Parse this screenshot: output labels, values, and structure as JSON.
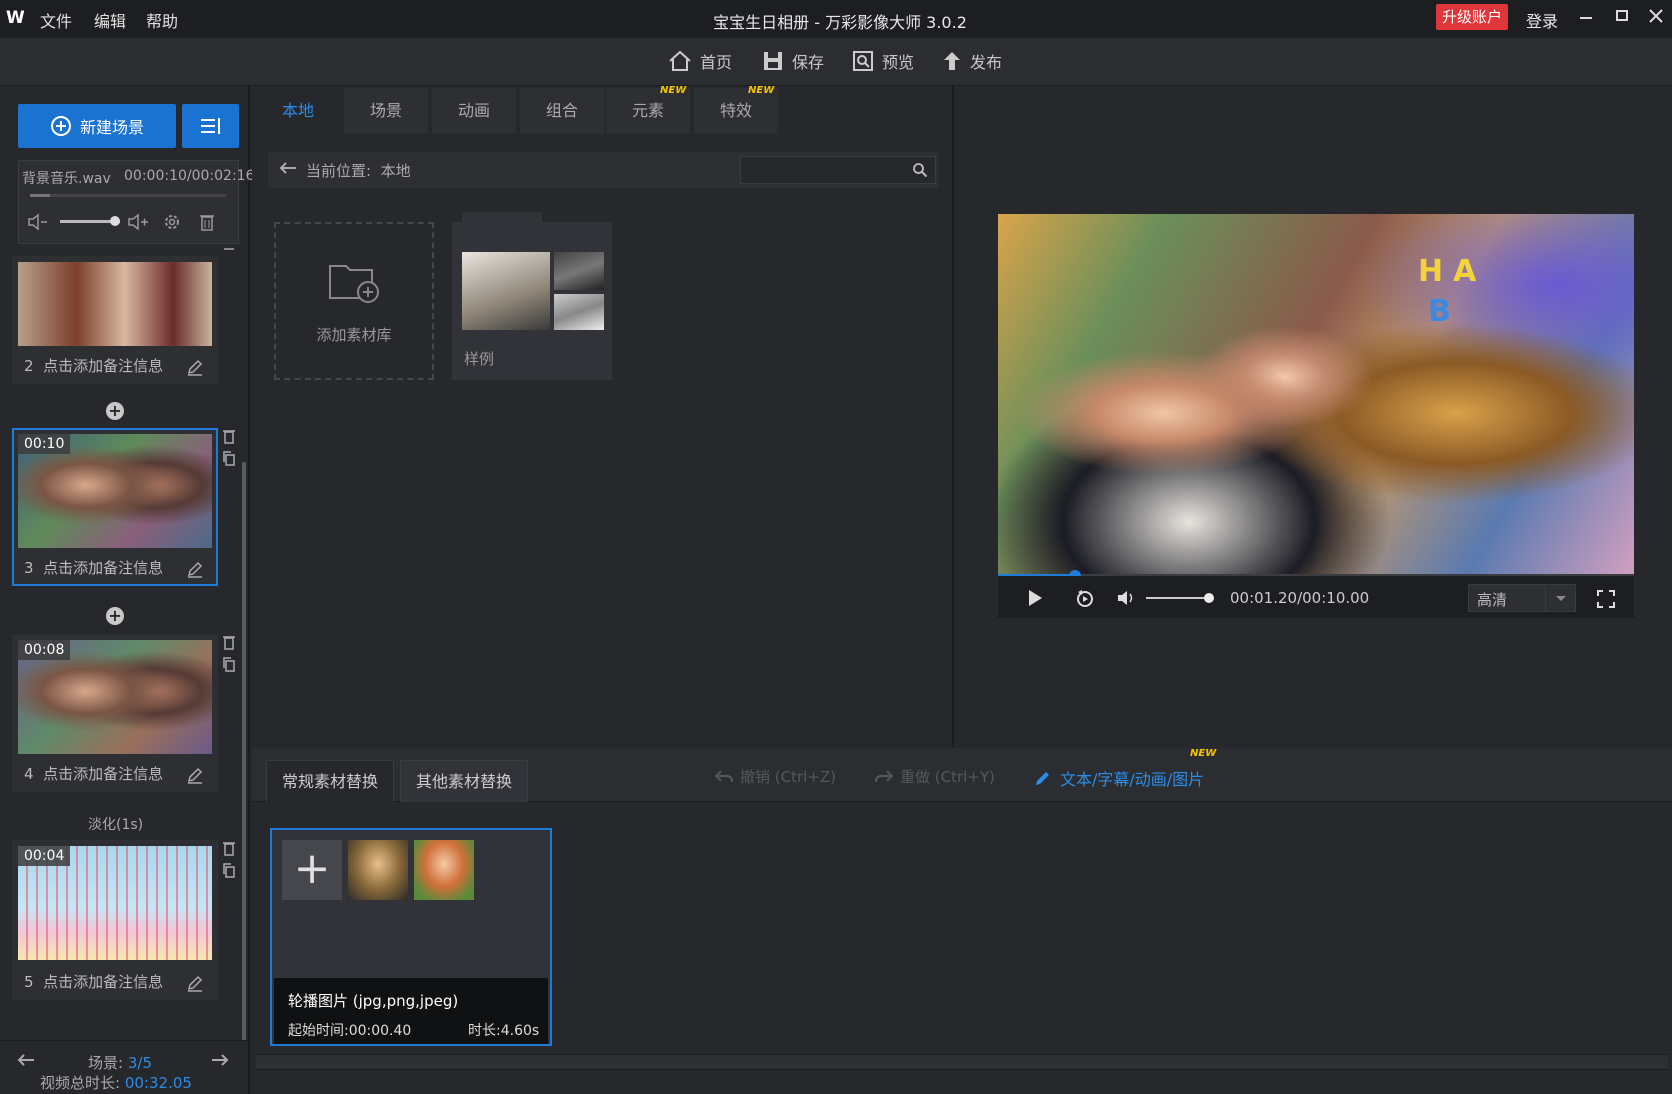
{
  "app": {
    "logo": "W",
    "title": "宝宝生日相册 - 万彩影像大师 3.0.2"
  },
  "menu": {
    "file": "文件",
    "edit": "编辑",
    "help": "帮助"
  },
  "account": {
    "upgrade": "升级账户",
    "login": "登录"
  },
  "toolbar": {
    "home": "首页",
    "save": "保存",
    "preview": "预览",
    "publish": "发布"
  },
  "left": {
    "new_scene": "新建场景",
    "music": {
      "name": "背景音乐.wav",
      "time": "00:00:10/00:02:16"
    },
    "scenes": [
      {
        "number": "2",
        "note": "点击添加备注信息",
        "duration": ""
      },
      {
        "number": "3",
        "note": "点击添加备注信息",
        "duration": "00:10"
      },
      {
        "number": "4",
        "note": "点击添加备注信息",
        "duration": "00:08"
      },
      {
        "number": "5",
        "note": "点击添加备注信息",
        "duration": "00:04"
      }
    ],
    "transition": "淡化(1s)",
    "footer": {
      "scene_label": "场景:",
      "scene_value": "3/5",
      "duration_label": "视频总时长:",
      "duration_value": "00:32.05"
    }
  },
  "library": {
    "tabs": [
      "本地",
      "场景",
      "动画",
      "组合",
      "元素",
      "特效"
    ],
    "new_badge": "NEW",
    "path_label": "当前位置:",
    "path_value": "本地",
    "search": {
      "placeholder": ""
    },
    "add_library": "添加素材库",
    "sample_folder": "样例"
  },
  "player": {
    "time": "00:01.20/00:10.00",
    "quality": "高清",
    "progress": 0.12
  },
  "bottom": {
    "tabs": [
      "常规素材替换",
      "其他素材替换"
    ],
    "undo": "撤销 (Ctrl+Z)",
    "redo": "重做 (Ctrl+Y)",
    "text_edit": "文本/字幕/动画/图片",
    "new_badge": "NEW",
    "asset": {
      "name": "轮播图片 (jpg,png,jpeg)",
      "start": "起始时间:00:00.40",
      "duration": "时长:4.60s"
    }
  }
}
